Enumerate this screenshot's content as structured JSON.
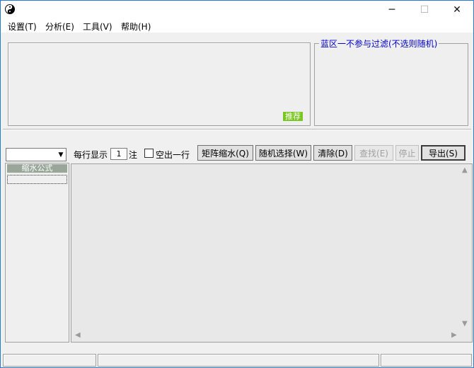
{
  "window": {
    "icon": "yin-yang-icon",
    "minimize": "─",
    "maximize": "☐",
    "close": "✕"
  },
  "menu": {
    "items": [
      "设置(T)",
      "分析(E)",
      "工具(V)",
      "帮助(H)"
    ]
  },
  "top_left_panel": {
    "recommend_label": "推荐"
  },
  "blue_zone": {
    "title": "蓝区一不参与过滤(不选则随机)"
  },
  "toolbar": {
    "per_row_label": "每行显示",
    "per_row_value": "1",
    "unit_label": "注",
    "empty_row_label": "空出一行",
    "buttons": [
      "矩阵缩水(Q)",
      "随机选择(W)",
      "清除(D)",
      "查找(E)",
      "停止",
      "导出(S)"
    ]
  },
  "formula_list": {
    "header": "缩水公式"
  },
  "colors": {
    "recommend_bg": "#7ac620",
    "group_title": "#0000c8",
    "list_header_bg": "#9aa69a"
  }
}
